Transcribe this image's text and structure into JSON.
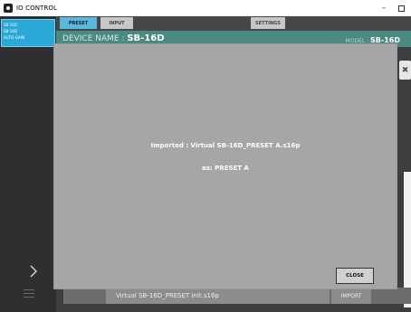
{
  "window": {
    "title": "IO CONTROL",
    "minimize_glyph": "–",
    "icon": "app-logo-icon"
  },
  "sidebar": {
    "device_lines": [
      "SB-16D",
      "SB-16D",
      "AUTO-GAIN"
    ],
    "expand_icon": "chevron-right-icon",
    "menu_icon": "hamburger-icon"
  },
  "tabs": {
    "preset": "PRESET",
    "input": "INPUT",
    "settings": "SETTINGS"
  },
  "device": {
    "name_label": "DEVICE NAME : ",
    "name_value": "SB-16D",
    "model_label": "MODEL : ",
    "model_value": "SB-16D"
  },
  "background_row": {
    "preset_name": "Virtual SB-16D_PRESET init.s16p",
    "import_label": "IMPORT"
  },
  "dialog": {
    "message_line1": "Imported : Virtual SB-16D_PRESET A.s16p",
    "message_line2": "as: PRESET A",
    "close_label": "CLOSE"
  },
  "side_close_glyph": "✖",
  "colors": {
    "accent": "#2aa8d8",
    "device_bar": "#4a8a82",
    "dialog_bg": "#a6a6a6",
    "app_bg": "#3e3e40"
  }
}
